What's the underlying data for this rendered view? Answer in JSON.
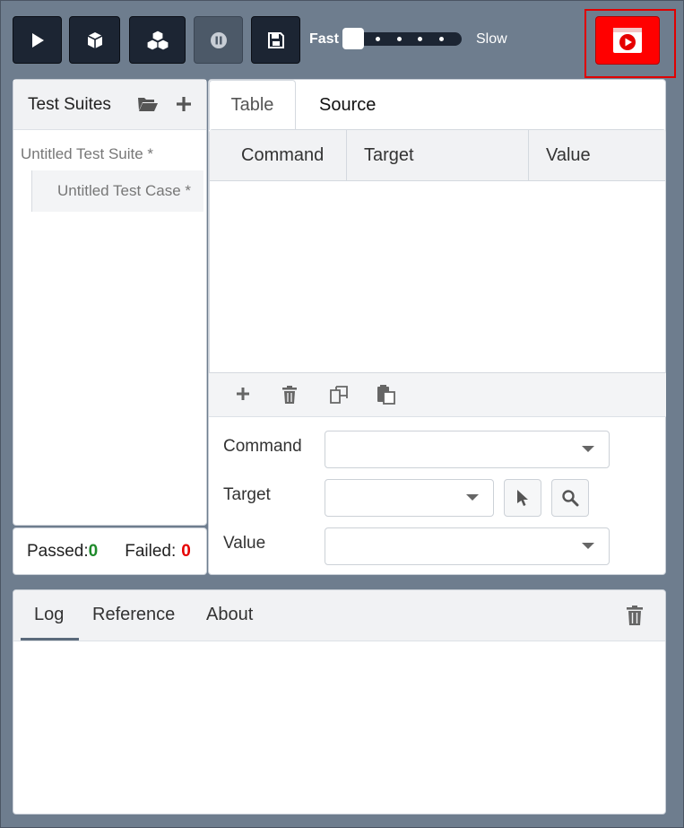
{
  "toolbar": {
    "speed_fast": "Fast",
    "speed_slow": "Slow",
    "speed_value_fraction": 0.0
  },
  "suites": {
    "title": "Test Suites",
    "suite_name": "Untitled Test Suite *",
    "case_name": "Untitled Test Case *"
  },
  "results": {
    "passed_label": "Passed:",
    "passed_value": "0",
    "failed_label": "Failed:",
    "failed_value": "0"
  },
  "editor": {
    "tabs": [
      "Table",
      "Source"
    ],
    "columns": [
      "Command",
      "Target",
      "Value"
    ],
    "form": {
      "command_label": "Command",
      "target_label": "Target",
      "value_label": "Value",
      "command_value": "",
      "target_value": "",
      "value_value": ""
    }
  },
  "log": {
    "tabs": [
      "Log",
      "Reference",
      "About"
    ]
  },
  "colors": {
    "background": "#6e7d8e",
    "toolbar_button": "#1c2533",
    "record_button": "#ff0000",
    "passed": "#1f8a2b",
    "failed": "#e60000"
  }
}
